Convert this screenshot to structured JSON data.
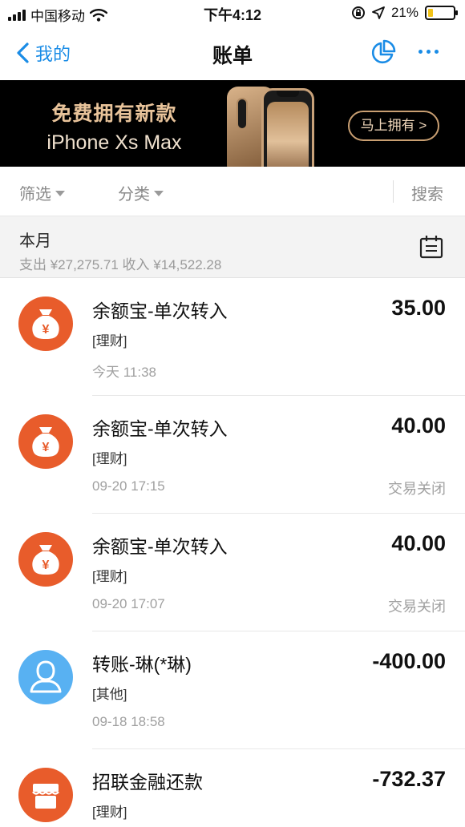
{
  "status_bar": {
    "carrier": "中国移动",
    "time": "下午4:12",
    "battery_text": "21%",
    "battery_level": 0.21,
    "icons": [
      "signal-icon",
      "wifi-icon",
      "rotation-lock-icon",
      "location-icon",
      "battery-icon"
    ]
  },
  "nav": {
    "back_label": "我的",
    "title": "账单",
    "icons": [
      "back-chevron-icon",
      "pie-chart-icon",
      "more-icon"
    ],
    "accent_color": "#1a8ce6"
  },
  "banner": {
    "line1": "免费拥有新款",
    "line2": "iPhone Xs Max",
    "button_label": "马上拥有 >"
  },
  "filters": {
    "filter_label": "筛选",
    "category_label": "分类",
    "search_label": "搜索"
  },
  "month": {
    "label": "本月",
    "summary": "支出 ¥27,275.71   收入 ¥14,522.28",
    "icon": "calendar-icon"
  },
  "transactions": [
    {
      "title": "余额宝-单次转入",
      "category": "[理财]",
      "time": "今天  11:38",
      "amount": "35.00",
      "status": "",
      "icon": "money-bag-icon",
      "icon_color": "#e85c2b"
    },
    {
      "title": "余额宝-单次转入",
      "category": "[理财]",
      "time": "09-20  17:15",
      "amount": "40.00",
      "status": "交易关闭",
      "icon": "money-bag-icon",
      "icon_color": "#e85c2b"
    },
    {
      "title": "余额宝-单次转入",
      "category": "[理财]",
      "time": "09-20  17:07",
      "amount": "40.00",
      "status": "交易关闭",
      "icon": "money-bag-icon",
      "icon_color": "#e85c2b"
    },
    {
      "title": "转账-琳(*琳)",
      "category": "[其他]",
      "time": "09-18  18:58",
      "amount": "-400.00",
      "status": "",
      "icon": "person-icon",
      "icon_color": "#58b1f2"
    },
    {
      "title": "招联金融还款",
      "category": "[理财]",
      "time": "",
      "amount": "-732.37",
      "status": "",
      "icon": "store-icon",
      "icon_color": "#e85c2b"
    }
  ]
}
